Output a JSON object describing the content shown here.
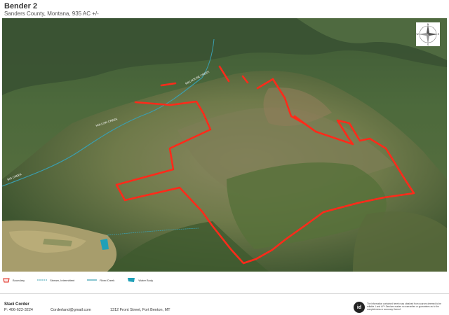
{
  "header": {
    "title": "Bender 2",
    "subtitle": "Sanders County, Montana, 935 AC +/-"
  },
  "map": {
    "creek_label_1": "MILLHOUSE CREEK",
    "creek_label_2": "HOLLOW CREEK",
    "creek_label_3": "BIG CREEK",
    "compass_n": "N",
    "compass_s": "S",
    "compass_e": "E",
    "compass_w": "W",
    "boundary_color": "#ff2a1a",
    "stream_color": "#3a9fb0",
    "water_color": "#1fa0b8"
  },
  "legend": {
    "items": [
      {
        "label": "Boundary",
        "icon": "boundary-icon"
      },
      {
        "label": "Stream, Intermittent",
        "icon": "stream-intermittent-icon"
      },
      {
        "label": "River/Creek",
        "icon": "river-creek-icon"
      },
      {
        "label": "Water Body",
        "icon": "water-body-icon"
      }
    ]
  },
  "footer": {
    "agent_name": "Staci Corder",
    "agent_phone": "P: 406-622-3224",
    "agent_email": "Corderland@gmail.com",
    "agent_address": "1312 Front Street, Fort Benton, MT",
    "logo_text": "id",
    "disclaimer": "The information contained herein was obtained from sources deemed to be reliable. Land id™ Services makes no warranties or guarantees as to the completeness or accuracy thereof."
  }
}
